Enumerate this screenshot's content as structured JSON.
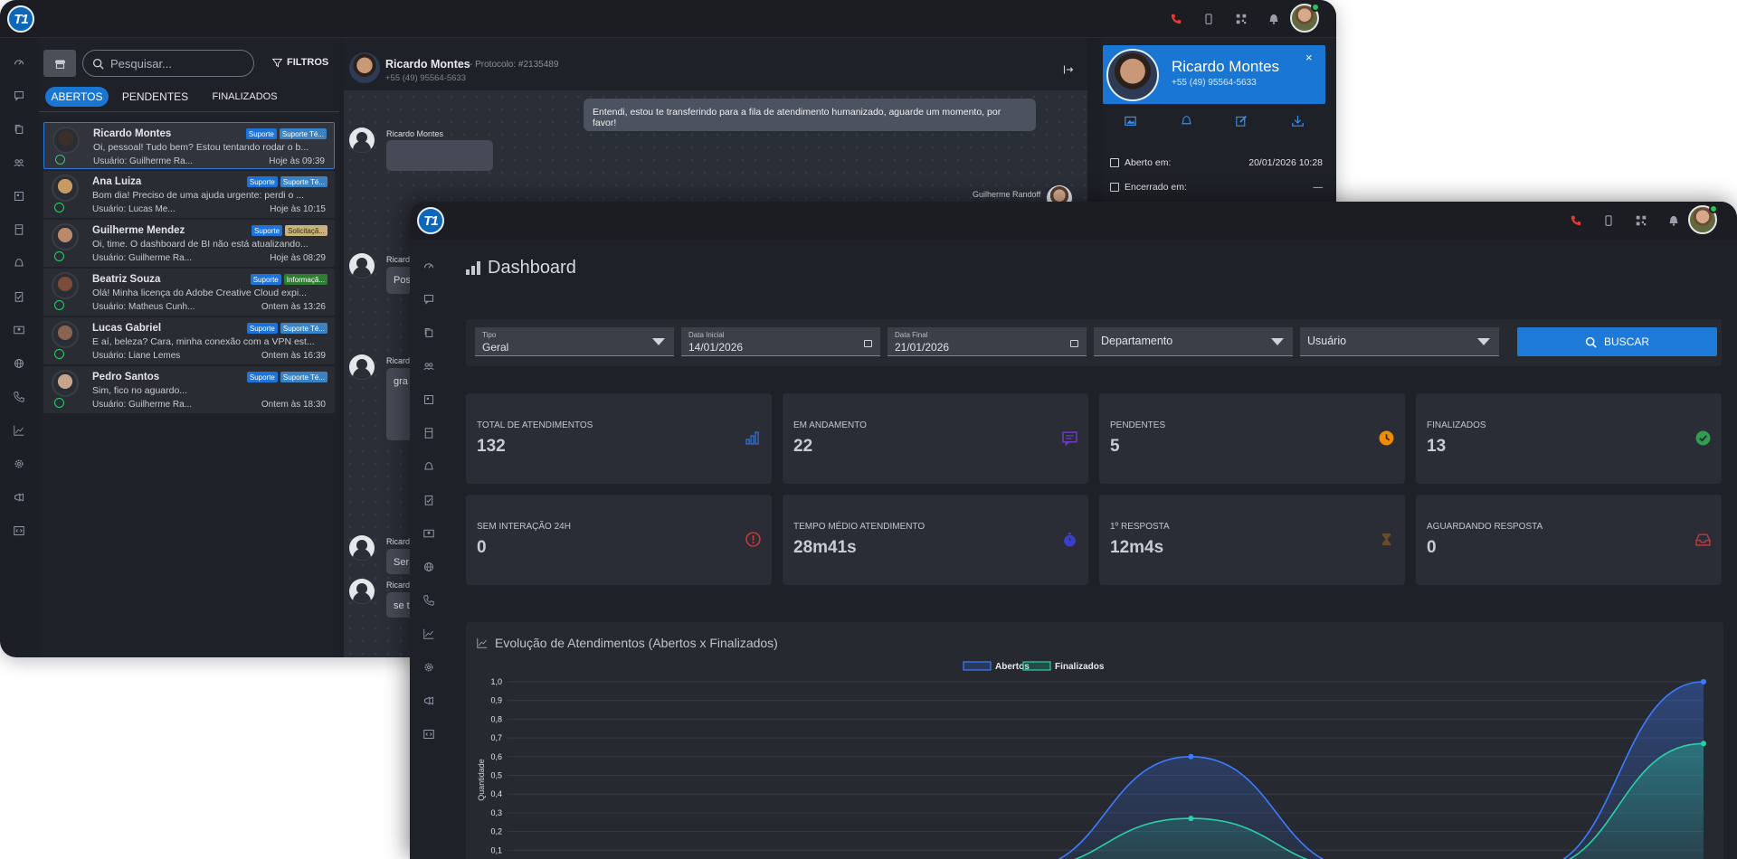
{
  "colors": {
    "accent": "#1976d2",
    "online": "#22c55e",
    "whatsapp": "#25d366",
    "abertos": "#3d7bff",
    "finalizados": "#2ad1a6"
  },
  "back_window": {
    "rail_icons": [
      "dashboard-icon",
      "chat-icon",
      "copy-icon",
      "users-icon",
      "store-icon",
      "building-icon",
      "bell-icon",
      "clipboard-icon",
      "contact-card-icon",
      "globe-icon",
      "phone-icon",
      "chart-line-icon",
      "gear-icon",
      "megaphone-icon",
      "code-icon"
    ],
    "search_placeholder": "Pesquisar...",
    "filters_label": "FILTROS",
    "tabs": [
      "ABERTOS",
      "PENDENTES",
      "FINALIZADOS"
    ],
    "conversations": [
      {
        "name": "Ricardo Montes",
        "tags": [
          "Suporte",
          "Suporte Té..."
        ],
        "tag2_style": "sky",
        "message": "Oi, pessoal! Tudo bem? Estou tentando rodar o b...",
        "user": "Usuário: Guilherme Ra...",
        "time": "Hoje às 09:39",
        "avatar_color": "#3a2f29"
      },
      {
        "name": "Ana Luiza",
        "tags": [
          "Suporte",
          "Suporte Té..."
        ],
        "tag2_style": "sky",
        "message": "Bom dia! Preciso de uma ajuda urgente: perdi o ...",
        "user": "Usuário: Lucas Me...",
        "time": "Hoje às 10:15",
        "avatar_color": "#c79a62"
      },
      {
        "name": "Guilherme Mendez",
        "tags": [
          "Suporte",
          "Solicitaçã..."
        ],
        "tag2_style": "tan",
        "message": "Oi, time. O dashboard de BI não está atualizando...",
        "user": "Usuário: Guilherme Ra...",
        "time": "Hoje às 08:29",
        "avatar_color": "#b88a6b"
      },
      {
        "name": "Beatriz Souza",
        "tags": [
          "Suporte",
          "Informaçã..."
        ],
        "tag2_style": "green",
        "message": "Olá! Minha licença do Adobe Creative Cloud expi...",
        "user": "Usuário: Matheus Cunh...",
        "time": "Ontem às 13:26",
        "avatar_color": "#7a4c3a"
      },
      {
        "name": "Lucas Gabriel",
        "tags": [
          "Suporte",
          "Suporte Té..."
        ],
        "tag2_style": "sky",
        "message": "E aí, beleza? Cara, minha conexão com a VPN est...",
        "user": "Usuário: Liane Lemes",
        "time": "Ontem às 16:39",
        "avatar_color": "#8a6450"
      },
      {
        "name": "Pedro Santos",
        "tags": [
          "Suporte",
          "Suporte Té..."
        ],
        "tag2_style": "sky",
        "message": "Sim, fico no aguardo...",
        "user": "Usuário: Guilherme Ra...",
        "time": "Ontem às 18:30",
        "avatar_color": "#c7a58c"
      }
    ],
    "chat_header": {
      "name": "Ricardo Montes",
      "protocol": "- Protocolo: #2135489",
      "phone": "+55 (49) 95564-5633"
    },
    "messages": {
      "outgoing_1": "Entendi, estou te transferindo para a fila de atendimento humanizado, aguarde um momento, por favor!",
      "incoming_name": "Ricardo Montes",
      "agent_name": "Guilherme Randoff",
      "partial_name": "Ricard",
      "partial_texts": [
        "Pos",
        "gra",
        "Ser",
        "se t"
      ]
    },
    "contact": {
      "name": "Ricardo Montes",
      "phone": "+55 (49) 95564-5633",
      "close": "×",
      "opened_label": "Aberto em:",
      "opened_value": "20/01/2026 10:28",
      "closed_label": "Encerrado em:",
      "closed_value": "—"
    }
  },
  "front_window": {
    "page_title": "Dashboard",
    "filters": {
      "tipo_label": "Tipo",
      "tipo_value": "Geral",
      "data_inicial_label": "Data Inicial",
      "data_inicial_value": "14/01/2026",
      "data_final_label": "Data Final",
      "data_final_value": "21/01/2026",
      "departamento_value": "Departamento",
      "usuario_value": "Usuário",
      "search_button": "BUSCAR"
    },
    "kpis": [
      {
        "label": "TOTAL DE ATENDIMENTOS",
        "value": "132",
        "icon": "bar-chart-icon",
        "color": "#2f6fd6"
      },
      {
        "label": "EM ANDAMENTO",
        "value": "22",
        "icon": "chat-bubble-icon",
        "color": "#6a3bc9"
      },
      {
        "label": "PENDENTES",
        "value": "5",
        "icon": "clock-icon",
        "color": "#f08c00"
      },
      {
        "label": "FINALIZADOS",
        "value": "13",
        "icon": "check-circle-icon",
        "color": "#2e9e4f"
      },
      {
        "label": "SEM INTERAÇÃO 24H",
        "value": "0",
        "icon": "alert-circle-icon",
        "color": "#d93636"
      },
      {
        "label": "TEMPO MÉDIO ATENDIMENTO",
        "value": "28m41s",
        "icon": "stopwatch-icon",
        "color": "#3b3fc7"
      },
      {
        "label": "1º RESPOSTA",
        "value": "12m4s",
        "icon": "hourglass-icon",
        "color": "#6b4a2e"
      },
      {
        "label": "AGUARDANDO RESPOSTA",
        "value": "0",
        "icon": "inbox-icon",
        "color": "#c6363c"
      }
    ]
  },
  "chart_data": {
    "type": "area",
    "title": "Evolução de Atendimentos (Abertos x Finalizados)",
    "ylabel": "Quantidade",
    "ylim": [
      0,
      1.0
    ],
    "yticks": [
      "1,0",
      "0,9",
      "0,8",
      "0,7",
      "0,6",
      "0,5",
      "0,4",
      "0,3",
      "0,2",
      "0,1"
    ],
    "legend_position": "top",
    "x": [
      0,
      1,
      2,
      3,
      4,
      5,
      6,
      7
    ],
    "series": [
      {
        "name": "Abertos",
        "values": [
          0,
          0,
          0,
          0,
          0.6,
          0,
          0,
          1.0
        ]
      },
      {
        "name": "Finalizados",
        "values": [
          0,
          0,
          0,
          0,
          0.27,
          0,
          0,
          0.67
        ]
      }
    ]
  }
}
